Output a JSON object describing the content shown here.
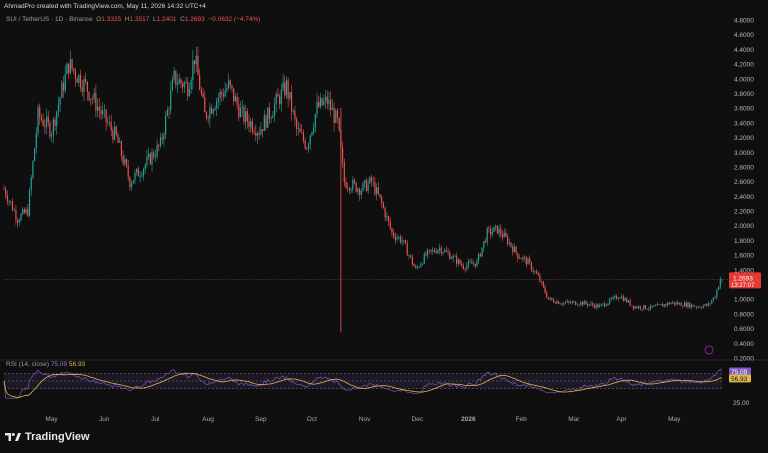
{
  "header": {
    "text": "AhmadPro created with TradingView.com, May 11, 2026 14:32 UTC+4"
  },
  "legend": {
    "symbol": "SUI / TetherUS · 1D · Binance",
    "o_label": "O",
    "o": "1.3325",
    "h_label": "H",
    "h": "1.3517",
    "l_label": "L",
    "l": "1.2401",
    "c_label": "C",
    "c": "1.2693",
    "change": "−0.0632 (−4.74%)"
  },
  "price_badge": {
    "price": "1.2693",
    "countdown": "13:27:07"
  },
  "rsi": {
    "legend_prefix": "RSI (14, close)",
    "rsi_value": "75.09",
    "ma_value": "56.93",
    "axis_label": "25.00"
  },
  "brand": {
    "name": "TradingView",
    "logo_icon": "tradingview-logo-icon"
  },
  "colors": {
    "up": "#26a69a",
    "down": "#ef5350",
    "rsi": "#7e57c2",
    "rsi_ma": "#e0b84a",
    "background": "#0f0f0f"
  },
  "chart_data": {
    "type": "candlestick",
    "price_axis": {
      "min": 0.2,
      "max": 4.8,
      "ticks": [
        "4.8000",
        "4.6000",
        "4.4000",
        "4.2000",
        "4.0000",
        "3.8000",
        "3.6000",
        "3.4000",
        "3.2000",
        "3.0000",
        "2.8000",
        "2.6000",
        "2.4000",
        "2.2000",
        "2.0000",
        "1.8000",
        "1.6000",
        "1.4000",
        "1.2000",
        "1.0000",
        "0.8000",
        "0.6000",
        "0.4000",
        "0.2000"
      ]
    },
    "x_axis_ticks": [
      "May",
      "Jun",
      "Jul",
      "Aug",
      "Sep",
      "Oct",
      "Nov",
      "Dec",
      "2026",
      "Feb",
      "Mar",
      "Apr",
      "May"
    ],
    "grid": false,
    "price_path": [
      {
        "d": 0,
        "p": 2.5
      },
      {
        "d": 8,
        "p": 2.1
      },
      {
        "d": 14,
        "p": 2.2
      },
      {
        "d": 20,
        "p": 3.5
      },
      {
        "d": 28,
        "p": 3.3
      },
      {
        "d": 38,
        "p": 4.2
      },
      {
        "d": 48,
        "p": 3.9
      },
      {
        "d": 58,
        "p": 3.5
      },
      {
        "d": 66,
        "p": 3.2
      },
      {
        "d": 74,
        "p": 2.6
      },
      {
        "d": 82,
        "p": 2.8
      },
      {
        "d": 92,
        "p": 3.1
      },
      {
        "d": 100,
        "p": 4.0
      },
      {
        "d": 108,
        "p": 3.9
      },
      {
        "d": 112,
        "p": 4.3
      },
      {
        "d": 118,
        "p": 3.5
      },
      {
        "d": 124,
        "p": 3.7
      },
      {
        "d": 132,
        "p": 3.9
      },
      {
        "d": 140,
        "p": 3.5
      },
      {
        "d": 150,
        "p": 3.3
      },
      {
        "d": 158,
        "p": 3.6
      },
      {
        "d": 166,
        "p": 3.9
      },
      {
        "d": 172,
        "p": 3.3
      },
      {
        "d": 178,
        "p": 3.1
      },
      {
        "d": 184,
        "p": 3.6
      },
      {
        "d": 190,
        "p": 3.7
      },
      {
        "d": 196,
        "p": 3.4
      },
      {
        "d": 200,
        "p": 2.6
      },
      {
        "d": 210,
        "p": 2.5
      },
      {
        "d": 216,
        "p": 2.6
      },
      {
        "d": 222,
        "p": 2.3
      },
      {
        "d": 228,
        "p": 1.9
      },
      {
        "d": 234,
        "p": 1.8
      },
      {
        "d": 238,
        "p": 1.6
      },
      {
        "d": 242,
        "p": 1.4
      },
      {
        "d": 248,
        "p": 1.6
      },
      {
        "d": 256,
        "p": 1.7
      },
      {
        "d": 262,
        "p": 1.6
      },
      {
        "d": 270,
        "p": 1.45
      },
      {
        "d": 278,
        "p": 1.5
      },
      {
        "d": 284,
        "p": 1.9
      },
      {
        "d": 290,
        "p": 1.95
      },
      {
        "d": 296,
        "p": 1.8
      },
      {
        "d": 302,
        "p": 1.6
      },
      {
        "d": 308,
        "p": 1.5
      },
      {
        "d": 314,
        "p": 1.3
      },
      {
        "d": 320,
        "p": 1.0
      },
      {
        "d": 328,
        "p": 0.95
      },
      {
        "d": 340,
        "p": 0.95
      },
      {
        "d": 350,
        "p": 0.9
      },
      {
        "d": 362,
        "p": 1.05
      },
      {
        "d": 370,
        "p": 0.9
      },
      {
        "d": 380,
        "p": 0.88
      },
      {
        "d": 392,
        "p": 0.95
      },
      {
        "d": 400,
        "p": 0.93
      },
      {
        "d": 408,
        "p": 0.9
      },
      {
        "d": 414,
        "p": 0.92
      },
      {
        "d": 418,
        "p": 1.05
      },
      {
        "d": 422,
        "p": 1.35
      }
    ],
    "wicks": [
      {
        "d": 198,
        "low": 0.55,
        "high": 3.6
      }
    ],
    "price_line": 1.2693,
    "rsi_last": 75.09,
    "rsi_ma_last": 56.93
  }
}
